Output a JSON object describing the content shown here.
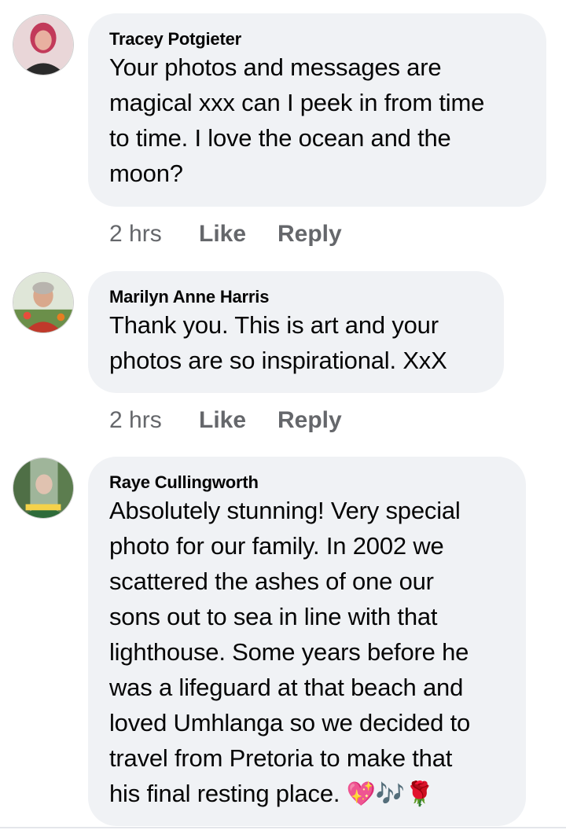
{
  "comments": [
    {
      "author": "Tracey Potgieter",
      "text": "Your photos and messages are\nmagical xxx can I peek in from time\nto time. I love the ocean and the\nmoon?",
      "time": "2 hrs",
      "like_label": "Like",
      "reply_label": "Reply"
    },
    {
      "author": "Marilyn Anne Harris",
      "text": "Thank you. This is art and your\nphotos are so inspirational. XxX",
      "time": "2 hrs",
      "like_label": "Like",
      "reply_label": "Reply"
    },
    {
      "author": "Raye Cullingworth",
      "text": "Absolutely stunning! Very special\nphoto for our family. In 2002 we\nscattered the ashes of one our\nsons out to sea in line with that\nlighthouse. Some years before he\nwas a lifeguard at that beach and\nloved Umhlanga so we decided to\ntravel from Pretoria to make that\nhis final resting place.",
      "emojis": {
        "heart": "💖",
        "notes": "🎶",
        "rose": "🌹"
      }
    }
  ]
}
